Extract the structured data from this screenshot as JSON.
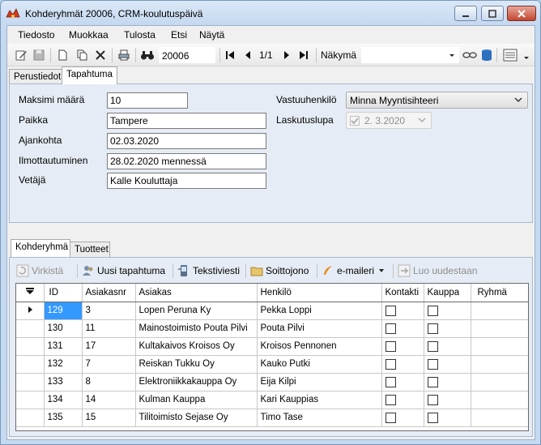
{
  "window": {
    "title": "Kohderyhmät 20006, CRM-koulutuspäivä"
  },
  "menu": [
    "Tiedosto",
    "Muokkaa",
    "Tulosta",
    "Etsi",
    "Näytä"
  ],
  "toolbar": {
    "record_id": "20006",
    "record_position": "1/1",
    "view_label": "Näkymä",
    "view_value": ""
  },
  "tabs_top": [
    {
      "label": "Perustiedot"
    },
    {
      "label": "Tapahtuma"
    }
  ],
  "form": {
    "max_count": {
      "label": "Maksimi määrä",
      "value": "10"
    },
    "place": {
      "label": "Paikka",
      "value": "Tampere"
    },
    "time": {
      "label": "Ajankohta",
      "value": "02.03.2020"
    },
    "registration": {
      "label": "Ilmottautuminen",
      "value": "28.02.2020 mennessä"
    },
    "leader": {
      "label": "Vetäjä",
      "value": "Kalle Kouluttaja"
    },
    "responsible": {
      "label": "Vastuuhenkilö",
      "value": "Minna Myyntisihteeri"
    },
    "billing": {
      "label": "Laskutuslupa",
      "value": "2.  3.2020"
    }
  },
  "tabs_bottom": [
    {
      "label": "Kohderyhmä"
    },
    {
      "label": "Tuotteet"
    }
  ],
  "subtoolbar": {
    "check": "Virkistä",
    "new_event": "Uusi tapahtuma",
    "sms": "Tekstiviesti",
    "call_queue": "Soittojono",
    "email": "e-maileri",
    "recreate": "Luo uudestaan"
  },
  "grid": {
    "columns": [
      "ID",
      "Asiakasnr",
      "Asiakas",
      "Henkilö",
      "Kontakti",
      "Kauppa",
      "Ryhmä"
    ],
    "rows": [
      {
        "id": "129",
        "asiakasnr": "3",
        "asiakas": "Lopen Peruna Ky",
        "henkilo": "Pekka Loppi"
      },
      {
        "id": "130",
        "asiakasnr": "11",
        "asiakas": "Mainostoimisto Pouta Pilvi",
        "henkilo": "Pouta Pilvi"
      },
      {
        "id": "131",
        "asiakasnr": "17",
        "asiakas": "Kultakaivos Kroisos Oy",
        "henkilo": "Kroisos Pennonen"
      },
      {
        "id": "132",
        "asiakasnr": "7",
        "asiakas": "Reiskan Tukku Oy",
        "henkilo": "Kauko Putki"
      },
      {
        "id": "133",
        "asiakasnr": "8",
        "asiakas": "Elektroniikkakauppa Oy",
        "henkilo": "Eija Kilpi"
      },
      {
        "id": "134",
        "asiakasnr": "14",
        "asiakas": "Kulman Kauppa",
        "henkilo": "Kari Kauppias"
      },
      {
        "id": "135",
        "asiakasnr": "15",
        "asiakas": "Tilitoimisto Sejase Oy",
        "henkilo": "Timo Tase"
      }
    ]
  },
  "colors": {
    "selection": "#3399ff",
    "panel": "#e6ecf5",
    "titlebar": "#c4d8ef"
  }
}
